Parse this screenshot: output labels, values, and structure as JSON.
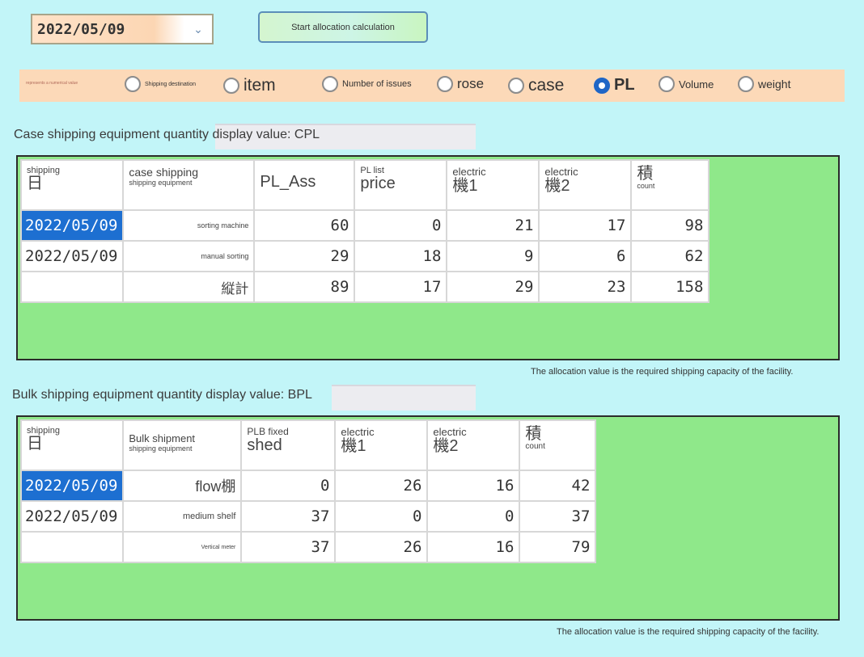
{
  "controls": {
    "date_value": "2022/05/09",
    "start_button": "Start allocation calculation"
  },
  "radio_bar": {
    "label": "represents a numerical value",
    "options": [
      {
        "label": "Shipping destination",
        "checked": false
      },
      {
        "label": "item",
        "checked": false
      },
      {
        "label": "Number of issues",
        "checked": false
      },
      {
        "label": "rose",
        "checked": false
      },
      {
        "label": "case",
        "checked": false
      },
      {
        "label": "PL",
        "checked": true
      },
      {
        "label": "Volume",
        "checked": false
      },
      {
        "label": "weight",
        "checked": false
      }
    ]
  },
  "case_section": {
    "title": "Case shipping equipment quantity display value: CPL",
    "headers": [
      {
        "top": "shipping",
        "big": "日"
      },
      {
        "top": "case shipping",
        "sub": "shipping equipment"
      },
      {
        "big": "PL_Ass"
      },
      {
        "top": "PL list",
        "big": "price"
      },
      {
        "top": "electric",
        "big": "機1"
      },
      {
        "top": "electric",
        "big": "機2"
      },
      {
        "big": "積",
        "sub": "count"
      }
    ],
    "rows": [
      {
        "date": "2022/05/09",
        "label": "sorting machine",
        "v1": "60",
        "v2": "0",
        "v3": "21",
        "v4": "17",
        "v5": "98"
      },
      {
        "date": "2022/05/09",
        "label": "manual sorting",
        "v1": "29",
        "v2": "18",
        "v3": "9",
        "v4": "6",
        "v5": "62"
      },
      {
        "date": "",
        "label": "縦計",
        "v1": "89",
        "v2": "17",
        "v3": "29",
        "v4": "23",
        "v5": "158"
      }
    ],
    "note": "The allocation value is the required shipping capacity of the facility."
  },
  "bulk_section": {
    "title": "Bulk shipping equipment quantity display value: BPL",
    "headers": [
      {
        "top": "shipping",
        "big": "日"
      },
      {
        "top": "Bulk shipment",
        "sub": "shipping equipment"
      },
      {
        "top": "PLB fixed",
        "big": "shed"
      },
      {
        "top": "electric",
        "big": "機1"
      },
      {
        "top": "electric",
        "big": "機2"
      },
      {
        "big": "積",
        "sub": "count"
      }
    ],
    "rows": [
      {
        "date": "2022/05/09",
        "label": "flow棚",
        "v1": "0",
        "v2": "26",
        "v3": "16",
        "v4": "42"
      },
      {
        "date": "2022/05/09",
        "label": "medium shelf",
        "v1": "37",
        "v2": "0",
        "v3": "0",
        "v4": "37"
      },
      {
        "date": "",
        "label": "Vertical meter",
        "v1": "37",
        "v2": "26",
        "v3": "16",
        "v4": "79"
      }
    ],
    "note": "The allocation value is the required shipping capacity of the facility."
  }
}
